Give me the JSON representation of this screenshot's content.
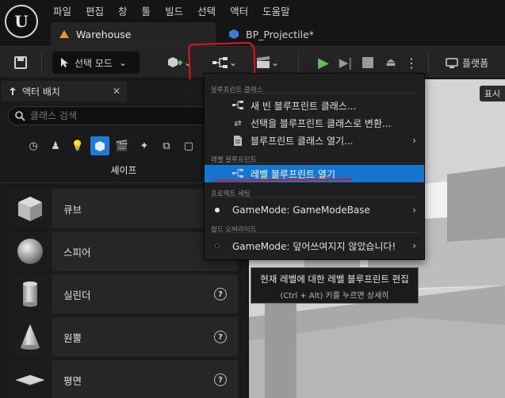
{
  "menu": [
    "파일",
    "편집",
    "창",
    "툴",
    "빌드",
    "선택",
    "액터",
    "도움말"
  ],
  "tabs": {
    "active": "Warehouse",
    "inactive": "BP_Projectile*"
  },
  "toolbar": {
    "mode_label": "선택 모드",
    "platform_label": "플랫폼"
  },
  "panel": {
    "title": "액터 배치",
    "search_placeholder": "클래스 검색",
    "category_label": "셰이프",
    "items": [
      {
        "label": "큐브",
        "help": "?"
      },
      {
        "label": "스피어",
        "help": "?"
      },
      {
        "label": "실린더",
        "help": "?"
      },
      {
        "label": "원뿔",
        "help": "?"
      },
      {
        "label": "평면",
        "help": "?"
      }
    ]
  },
  "viewport": {
    "label": "표시"
  },
  "blueprint_menu": {
    "section_class": "블루프린트 클래스",
    "new_class": "새 빈 블루프린트 클래스...",
    "convert": "선택을 블루프린트 클래스로 변환...",
    "open_class": "블루프린트 클래스 열기...",
    "section_level": "레벨 블루프린트",
    "open_level": "레벨 블루프린트 열기",
    "section_project": "프로젝트 세팅",
    "project_gamemode": "GameMode: GameModeBase",
    "section_world": "월드 오버라이드",
    "world_gamemode": "GameMode: 덮어쓰여지지 않았습니다!"
  },
  "tooltip": {
    "title": "현재 레벨에 대한 레벨 블루프린트 편집",
    "hint": "(Ctrl + Alt) 키를 누르면 상세히"
  },
  "colors": {
    "highlight": "#1576d2",
    "play": "#5ec15e",
    "annotation": "#e0141e"
  }
}
